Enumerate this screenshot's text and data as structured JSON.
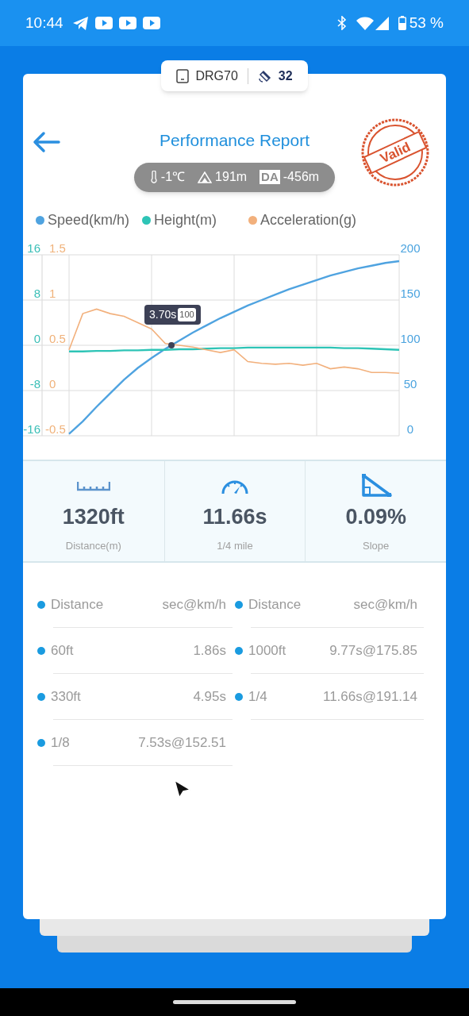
{
  "status_bar": {
    "time": "10:44",
    "battery": "53 %"
  },
  "device_pill": {
    "device": "DRG70",
    "satellites": "32"
  },
  "header": {
    "title": "Performance Report",
    "conditions": [
      {
        "kind": "temperature",
        "text": "-1℃"
      },
      {
        "kind": "altitude",
        "text": "191m"
      },
      {
        "kind": "density_altitude",
        "badge": "DA",
        "text": "-456m"
      }
    ],
    "stamp": "Valid"
  },
  "chart": {
    "tooltip": {
      "time": "3.70s",
      "value": "100"
    },
    "charts": [
      {
        "chart_data": {
          "type": "line",
          "categories": [
            null,
            null,
            null,
            null,
            null,
            null,
            null,
            null,
            null,
            null,
            null,
            null,
            null,
            null,
            null,
            null,
            null,
            null,
            null,
            null,
            null,
            null,
            null,
            null,
            null
          ],
          "ylim": [
            0,
            200
          ],
          "yticks": [
            0,
            50,
            100,
            150,
            200
          ],
          "series": [
            {
              "name": "Speed(km/h)",
              "color": "#4fa3e0",
              "values": [
                2,
                16,
                32,
                47,
                62,
                75,
                86,
                96,
                105,
                114,
                122,
                130,
                137,
                144,
                150,
                156,
                162,
                167,
                172,
                177,
                181,
                185,
                188,
                191,
                193
              ]
            }
          ]
        }
      },
      {
        "chart_data": {
          "type": "line",
          "categories": [
            null,
            null,
            null,
            null,
            null,
            null,
            null,
            null,
            null,
            null,
            null,
            null,
            null,
            null,
            null,
            null,
            null,
            null,
            null,
            null,
            null,
            null,
            null,
            null,
            null
          ],
          "ylim": [
            -16,
            16
          ],
          "yticks": [
            -16,
            -8,
            0,
            8,
            16
          ],
          "series": [
            {
              "name": "Height(m)",
              "color": "#2ec4b6",
              "values": [
                -1.1,
                -1.1,
                -1.0,
                -1.0,
                -0.9,
                -0.9,
                -0.8,
                -0.8,
                -0.7,
                -0.7,
                -0.6,
                -0.5,
                -0.5,
                -0.4,
                -0.4,
                -0.4,
                -0.4,
                -0.4,
                -0.4,
                -0.4,
                -0.5,
                -0.5,
                -0.6,
                -0.7,
                -0.8
              ]
            }
          ]
        }
      },
      {
        "chart_data": {
          "type": "line",
          "categories": [
            null,
            null,
            null,
            null,
            null,
            null,
            null,
            null,
            null,
            null,
            null,
            null,
            null,
            null,
            null,
            null,
            null,
            null,
            null,
            null,
            null,
            null,
            null,
            null,
            null
          ],
          "ylim": [
            -0.5,
            1.5
          ],
          "yticks": [
            -0.5,
            0,
            0.5,
            1,
            1.5
          ],
          "series": [
            {
              "name": "Acceleration(g)",
              "color": "#f2b07c",
              "values": [
                0.45,
                0.85,
                0.9,
                0.85,
                0.82,
                0.75,
                0.68,
                0.52,
                0.5,
                0.48,
                0.45,
                0.42,
                0.45,
                0.32,
                0.3,
                0.29,
                0.3,
                0.28,
                0.3,
                0.24,
                0.26,
                0.24,
                0.2,
                0.2,
                0.19
              ]
            }
          ]
        }
      }
    ]
  },
  "stats": [
    {
      "kind": "distance",
      "value": "1320ft",
      "label": "Distance(m)"
    },
    {
      "kind": "time",
      "value": "11.66s",
      "label": "1/4 mile"
    },
    {
      "kind": "slope",
      "value": "0.09%",
      "label": "Slope"
    }
  ],
  "results": [
    {
      "rows": [
        {
          "label": "Distance",
          "value": "sec@km/h"
        },
        {
          "label": "60ft",
          "value": "1.86s"
        },
        {
          "label": "330ft",
          "value": "4.95s"
        },
        {
          "label": "1/8",
          "value": "7.53s@152.51"
        }
      ]
    },
    {
      "rows": [
        {
          "label": "Distance",
          "value": "sec@km/h"
        },
        {
          "label": "1000ft",
          "value": "9.77s@175.85"
        },
        {
          "label": "1/4",
          "value": "11.66s@191.14"
        }
      ]
    }
  ]
}
